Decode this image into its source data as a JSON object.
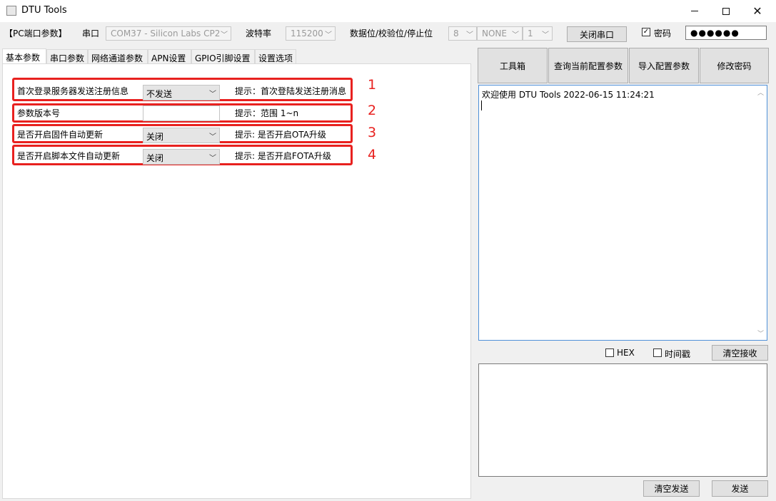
{
  "window": {
    "title": "DTU Tools"
  },
  "toolbar": {
    "pc_port_label": "【PC端口参数】",
    "serial_label": "串口",
    "serial_value": "COM37 - Silicon Labs CP2",
    "baud_label": "波特率",
    "baud_value": "115200",
    "format_label": "数据位/校验位/停止位",
    "databits_value": "8",
    "parity_value": "NONE",
    "stopbits_value": "1",
    "close_port_label": "关闭串口",
    "password_label": "密码",
    "password_checked": true,
    "password_value": "●●●●●●"
  },
  "tabs": [
    {
      "label": "基本参数",
      "active": true
    },
    {
      "label": "串口参数",
      "active": false
    },
    {
      "label": "网络通道参数",
      "active": false
    },
    {
      "label": "APN设置",
      "active": false
    },
    {
      "label": "GPIO引脚设置",
      "active": false
    },
    {
      "label": "设置选项",
      "active": false
    }
  ],
  "params": [
    {
      "label": "首次登录服务器发送注册信息",
      "value": "不发送",
      "type": "select",
      "hint": "提示：首次登陆发送注册消息",
      "num": "1"
    },
    {
      "label": "参数版本号",
      "value": "",
      "type": "input",
      "hint": "提示：范围 1~n",
      "num": "2"
    },
    {
      "label": "是否开启固件自动更新",
      "value": "关闭",
      "type": "select",
      "hint": "提示: 是否开启OTA升级",
      "num": "3"
    },
    {
      "label": "是否开启脚本文件自动更新",
      "value": "关闭",
      "type": "select",
      "hint": "提示: 是否开启FOTA升级",
      "num": "4"
    }
  ],
  "tools": [
    {
      "label": "工具箱"
    },
    {
      "label": "查询当前配置参数"
    },
    {
      "label": "导入配置参数"
    },
    {
      "label": "修改密码"
    }
  ],
  "receive": {
    "text": "欢迎使用 DTU Tools 2022-06-15 11:24:21",
    "hex_label": "HEX",
    "timestamp_label": "时间戳",
    "clear_label": "清空接收"
  },
  "send": {
    "clear_label": "清空发送",
    "send_label": "发送"
  }
}
